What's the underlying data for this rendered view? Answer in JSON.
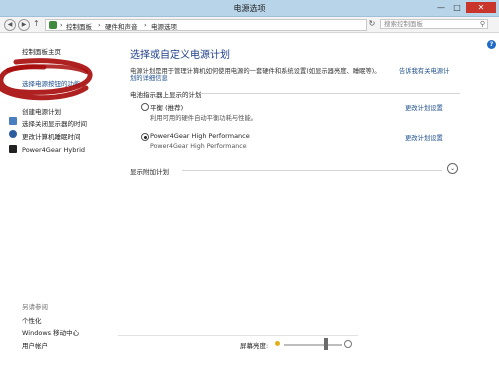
{
  "window": {
    "title": "电源选项",
    "min": "—",
    "max": "□",
    "close": "✕"
  },
  "address_bar": {
    "crumbs": [
      "控制面板",
      "硬件和声音",
      "电源选项"
    ],
    "separator": "›",
    "search_placeholder": "搜索控制面板"
  },
  "sidebar": {
    "home": "控制面板主页",
    "links": [
      {
        "label": "选择电源按钮的功能",
        "icon": "none"
      },
      {
        "label": "创建电源计划",
        "icon": "none"
      },
      {
        "label": "选择关闭显示器的时间",
        "icon": "monitor-icon"
      },
      {
        "label": "更改计算机睡眠时间",
        "icon": "moon-icon"
      },
      {
        "label": "Power4Gear Hybrid",
        "icon": "power4gear-icon"
      }
    ],
    "see_also_title": "另请参阅",
    "see_also": [
      "个性化",
      "Windows 移动中心",
      "用户帐户"
    ]
  },
  "main": {
    "heading": "选择或自定义电源计划",
    "description": "电源计划是用于管理计算机如何使用电源的一套硬件和系统设置(如显示器亮度、睡眠等)。",
    "description_link_part1": "告诉我有关电源计",
    "description_link_part2": "划的详细信息",
    "section_title": "电池指示器上显示的计划",
    "plans": [
      {
        "name": "平衡 (推荐)",
        "desc": "利用可用的硬件自动平衡功耗与性能。",
        "selected": false,
        "action": "更改计划设置"
      },
      {
        "name": "Power4Gear High Performance",
        "desc": "Power4Gear High Performance",
        "selected": true,
        "action": "更改计划设置"
      }
    ],
    "extra_plans": "显示附加计划"
  },
  "footer": {
    "brightness_label": "屏幕亮度:",
    "brightness_level": 0.72
  },
  "colors": {
    "accent": "#1c4d8c",
    "titlebar": "#b7d4e9",
    "close": "#c9342b",
    "annotation": "#a80d0d"
  }
}
